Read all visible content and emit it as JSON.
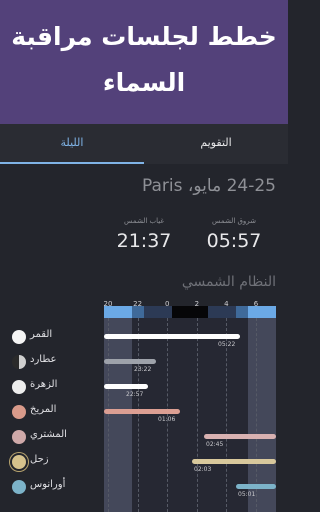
{
  "header": {
    "title_line1": "خطط لجلسات مراقبة",
    "title_line2": "السماء"
  },
  "tabs": [
    {
      "label": "الليلة",
      "active": true
    },
    {
      "label": "التقويم",
      "active": false
    }
  ],
  "date": {
    "label": "24-25 مايو، Paris"
  },
  "sun": {
    "rise_label": "شروق الشمس",
    "rise_time": "05:57",
    "set_label": "غياب الشمس",
    "set_time": "21:37"
  },
  "solar_system": {
    "title": "النظام الشمسي",
    "hour_ticks": [
      "20",
      "22",
      "0",
      "2",
      "4",
      "6"
    ],
    "planets": [
      {
        "name": "القمر",
        "icon": "moon-icon",
        "color": "#f4f4f4",
        "bar_color": "#ffffff",
        "time": "05:22"
      },
      {
        "name": "عطارد",
        "icon": "mercury-icon",
        "color": "#9a9a9a",
        "bar_color": "#9ea2aa",
        "time": "23:22"
      },
      {
        "name": "الزهرة",
        "icon": "venus-icon",
        "color": "#ededed",
        "bar_color": "#ffffff",
        "time": "22:57"
      },
      {
        "name": "المريخ",
        "icon": "mars-icon",
        "color": "#d89a8a",
        "bar_color": "#dc9f93",
        "time": "01:06"
      },
      {
        "name": "المشتري",
        "icon": "jupiter-icon",
        "color": "#cfa9a9",
        "bar_color": "#d8b1b1",
        "time": "02:45"
      },
      {
        "name": "زحل",
        "icon": "saturn-icon",
        "color": "#d6c28c",
        "bar_color": "#d8c89c",
        "time": "02:03"
      },
      {
        "name": "أورانوس",
        "icon": "uranus-icon",
        "color": "#7cb3c9",
        "bar_color": "#7cb3c9",
        "time": "05:01"
      }
    ]
  }
}
